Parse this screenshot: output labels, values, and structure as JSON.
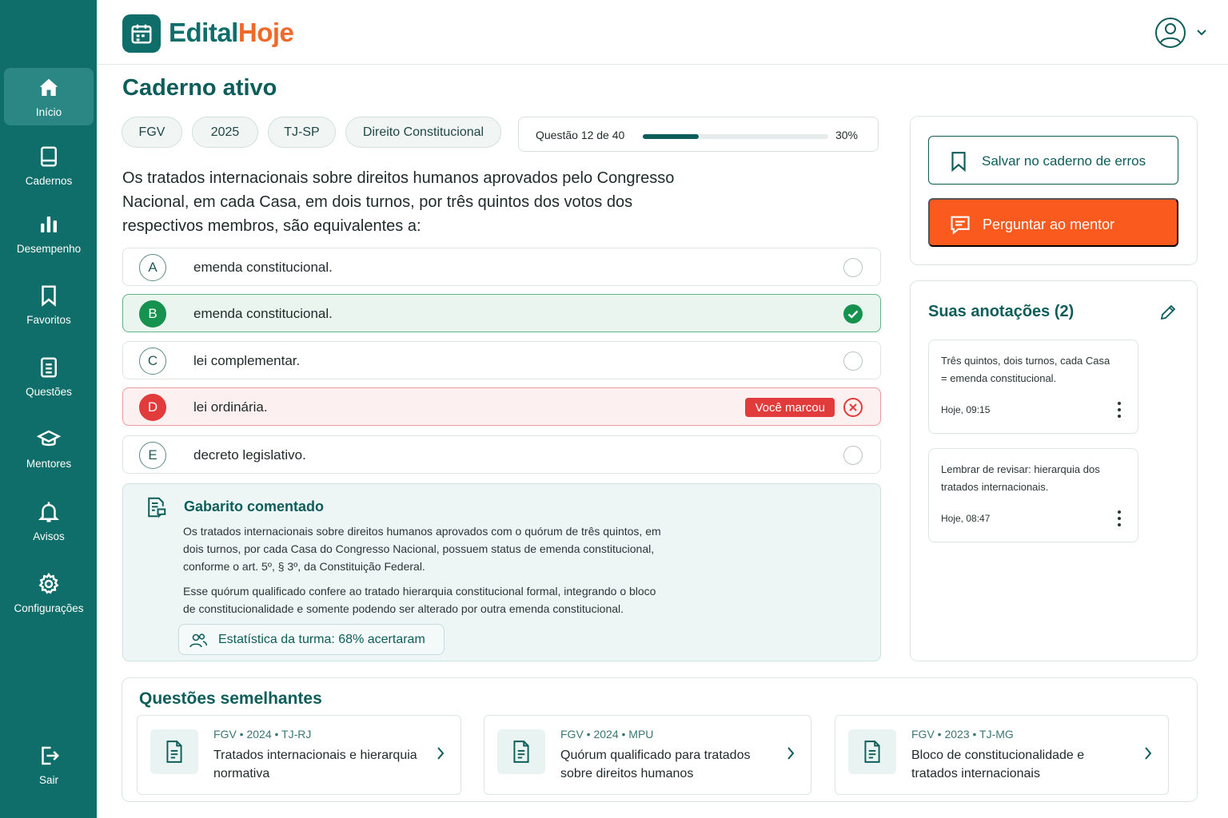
{
  "app": {
    "brand_part1": "Edital",
    "brand_part2": "Hoje"
  },
  "sidebar": {
    "items": [
      {
        "label": "Início",
        "icon": "home-icon",
        "active": true
      },
      {
        "label": "Cadernos",
        "icon": "notebook-icon"
      },
      {
        "label": "Desempenho",
        "icon": "bar-chart-icon"
      },
      {
        "label": "Favoritos",
        "icon": "bookmark-icon"
      },
      {
        "label": "Questões",
        "icon": "document-icon"
      },
      {
        "label": "Mentores",
        "icon": "graduation-cap-icon"
      },
      {
        "label": "Avisos",
        "icon": "bell-icon"
      },
      {
        "label": "Configurações",
        "icon": "gear-icon"
      }
    ],
    "logout": {
      "label": "Sair",
      "icon": "logout-icon"
    }
  },
  "page": {
    "title": "Caderno ativo"
  },
  "tags": [
    "FGV",
    "2025",
    "TJ-SP",
    "Direito Constitucional"
  ],
  "progress": {
    "label": "Questão 12 de 40",
    "percent_label": "30%",
    "fraction": 0.3
  },
  "question": {
    "text": "Os tratados internacionais sobre direitos humanos aprovados pelo Congresso Nacional, em cada Casa, em dois turnos, por três quintos dos votos dos respectivos membros, são equivalentes a:",
    "options": [
      {
        "letter": "A",
        "text": "emenda constitucional.",
        "state": "neutral"
      },
      {
        "letter": "B",
        "text": "emenda constitucional.",
        "state": "correct"
      },
      {
        "letter": "C",
        "text": "lei complementar.",
        "state": "neutral"
      },
      {
        "letter": "D",
        "text": "lei ordinária.",
        "state": "wrong",
        "badge": "Você marcou"
      },
      {
        "letter": "E",
        "text": "decreto legislativo.",
        "state": "neutral"
      }
    ]
  },
  "explanation": {
    "title": "Gabarito comentado",
    "paragraph1": "Os tratados internacionais  sobre direitos humanos  aprovados com o quórum de três quintos, em dois turnos, por cada Casa do Congresso Nacional, possuem status de emenda constitucional, conforme o art. 5º, § 3º, da Constituição Federal.",
    "paragraph2": "Esse quórum qualificado confere ao tratado hierarquia constitucional formal, integrando o bloco de constitucionalidade e somente podendo ser alterado por outra emenda constitucional.",
    "stat": "Estatística da turma: 68% acertaram"
  },
  "actions": {
    "save_label": "Salvar no caderno de erros",
    "mentor_label": "Perguntar ao mentor"
  },
  "notes": {
    "title": "Suas anotações (2)",
    "items": [
      {
        "text": "Três quintos, dois turnos, cada Casa = emenda constitucional.",
        "time": "Hoje, 09:15"
      },
      {
        "text": "Lembrar de revisar: hierarquia dos tratados internacionais.",
        "time": "Hoje, 08:47"
      }
    ]
  },
  "similar": {
    "title": "Questões semelhantes",
    "items": [
      {
        "meta": "FGV  •  2024  •  TJ-RJ",
        "title": "Tratados internacionais e hierarquia normativa"
      },
      {
        "meta": "FGV  •  2024  •  MPU",
        "title": "Quórum qualificado para tratados sobre direitos humanos"
      },
      {
        "meta": "FGV  •  2023  •  TJ-MG",
        "title": "Bloco de constitucionalidade e tratados internacionais"
      }
    ]
  },
  "colors": {
    "primary": "#0f6d6a",
    "accent": "#fa5a1e",
    "success": "#16924f",
    "error": "#e23b3b"
  }
}
